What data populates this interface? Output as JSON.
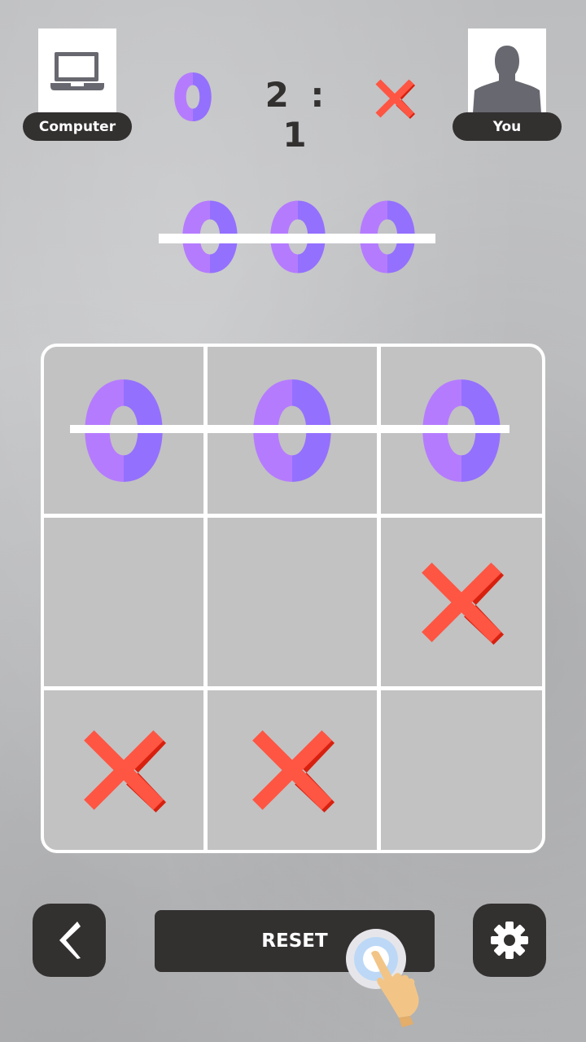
{
  "players": {
    "computer": {
      "label": "Computer",
      "icon": "laptop-icon",
      "mark": "O"
    },
    "you": {
      "label": "You",
      "icon": "user-silhouette-icon",
      "mark": "X"
    }
  },
  "score": {
    "computer": "2",
    "separator": ":",
    "you": "1"
  },
  "result_banner": {
    "marks": [
      "O",
      "O",
      "O"
    ],
    "struck_through": true
  },
  "board": {
    "rows": [
      [
        "O",
        "O",
        "O"
      ],
      [
        "",
        "",
        "X"
      ],
      [
        "X",
        "X",
        ""
      ]
    ],
    "winning_line": "top-row"
  },
  "controls": {
    "back_icon": "chevron-left-icon",
    "reset_label": "RESET",
    "settings_icon": "gear-icon",
    "hint_icon": "tap-hand-icon"
  },
  "colors": {
    "o_light": "#b57bff",
    "o_dark": "#9470ff",
    "x_main": "#ff5543",
    "x_shade": "#d8200f",
    "dark_ui": "#333030"
  }
}
